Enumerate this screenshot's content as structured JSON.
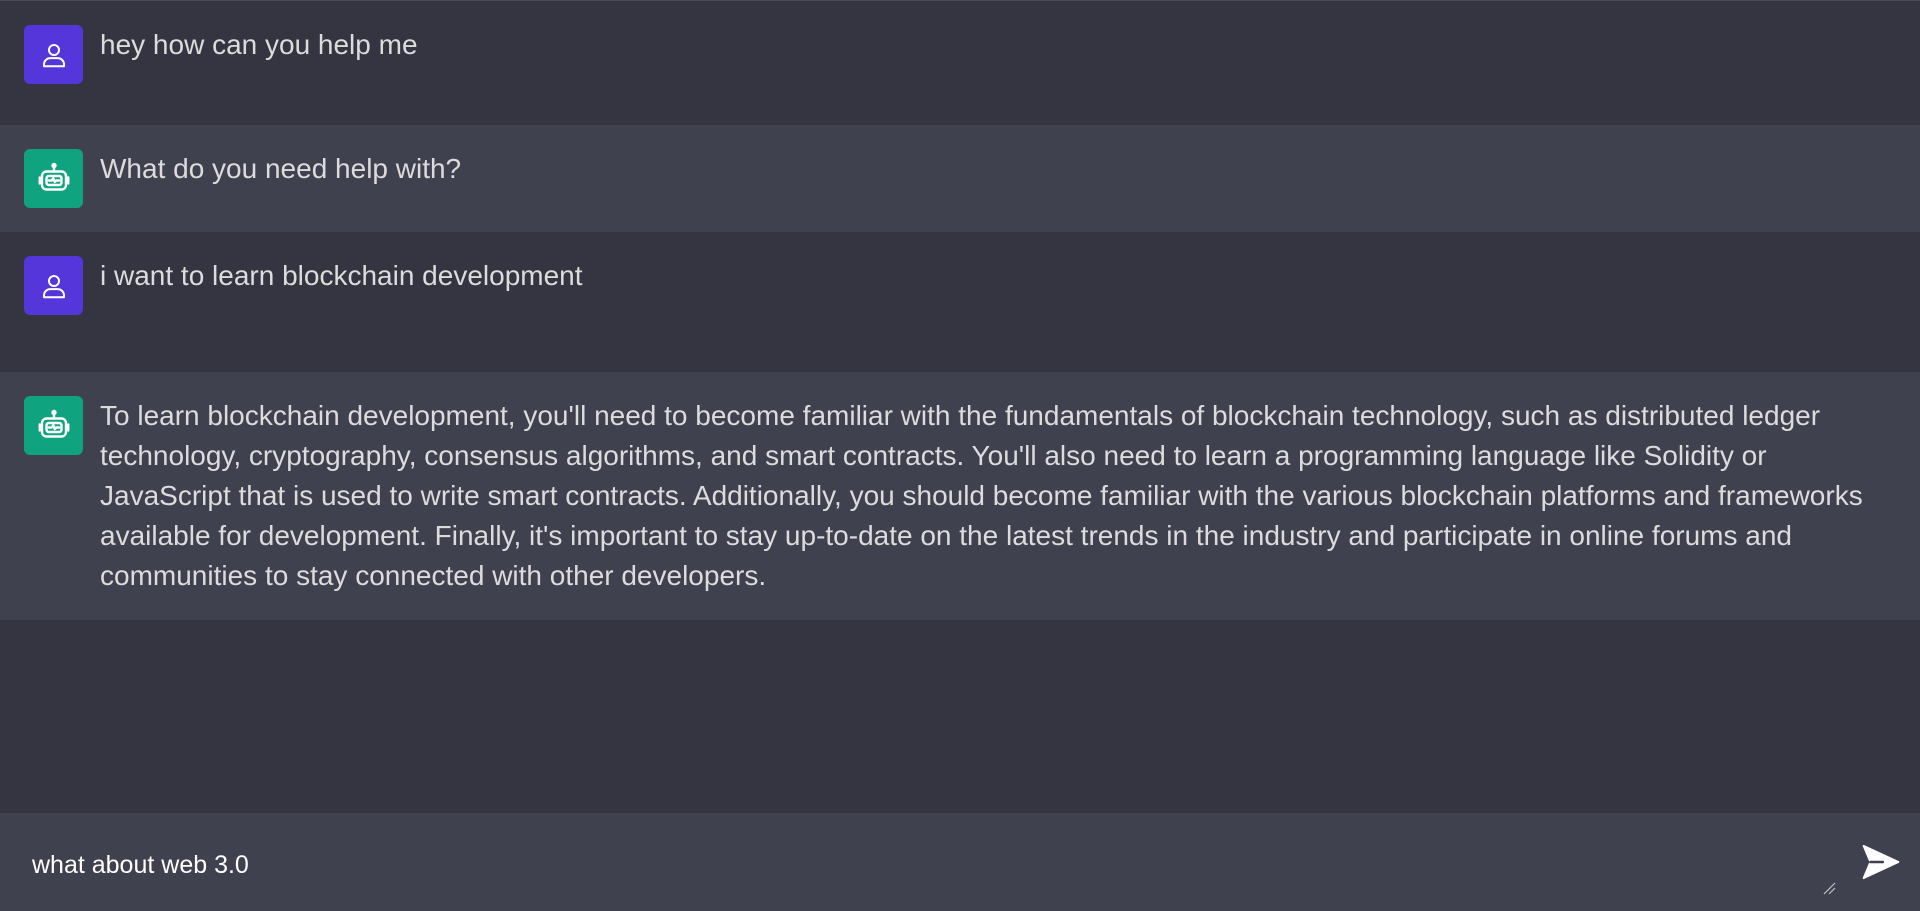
{
  "conversation": {
    "messages": [
      {
        "role": "user",
        "avatar_icon": "user-icon",
        "text": "hey how can you help me"
      },
      {
        "role": "bot",
        "avatar_icon": "robot-icon",
        "text": "What do you need help with?"
      },
      {
        "role": "user",
        "avatar_icon": "user-icon",
        "text": "i want to learn blockchain development"
      },
      {
        "role": "bot",
        "avatar_icon": "robot-icon",
        "text": "To learn blockchain development, you'll need to become familiar with the fundamentals of blockchain technology, such as distributed ledger technology, cryptography, consensus algorithms, and smart contracts. You'll also need to learn a programming language like Solidity or JavaScript that is used to write smart contracts. Additionally, you should become familiar with the various blockchain platforms and frameworks available for development. Finally, it's important to stay up-to-date on the latest trends in the industry and participate in online forums and communities to stay connected with other developers."
      }
    ]
  },
  "composer": {
    "value": "what about web 3.0",
    "send_icon": "send-icon"
  },
  "colors": {
    "background": "#343541",
    "bot_row": "#40414f",
    "user_avatar": "#5436da",
    "bot_avatar": "#10a37f",
    "text": "#dcdcdc"
  }
}
